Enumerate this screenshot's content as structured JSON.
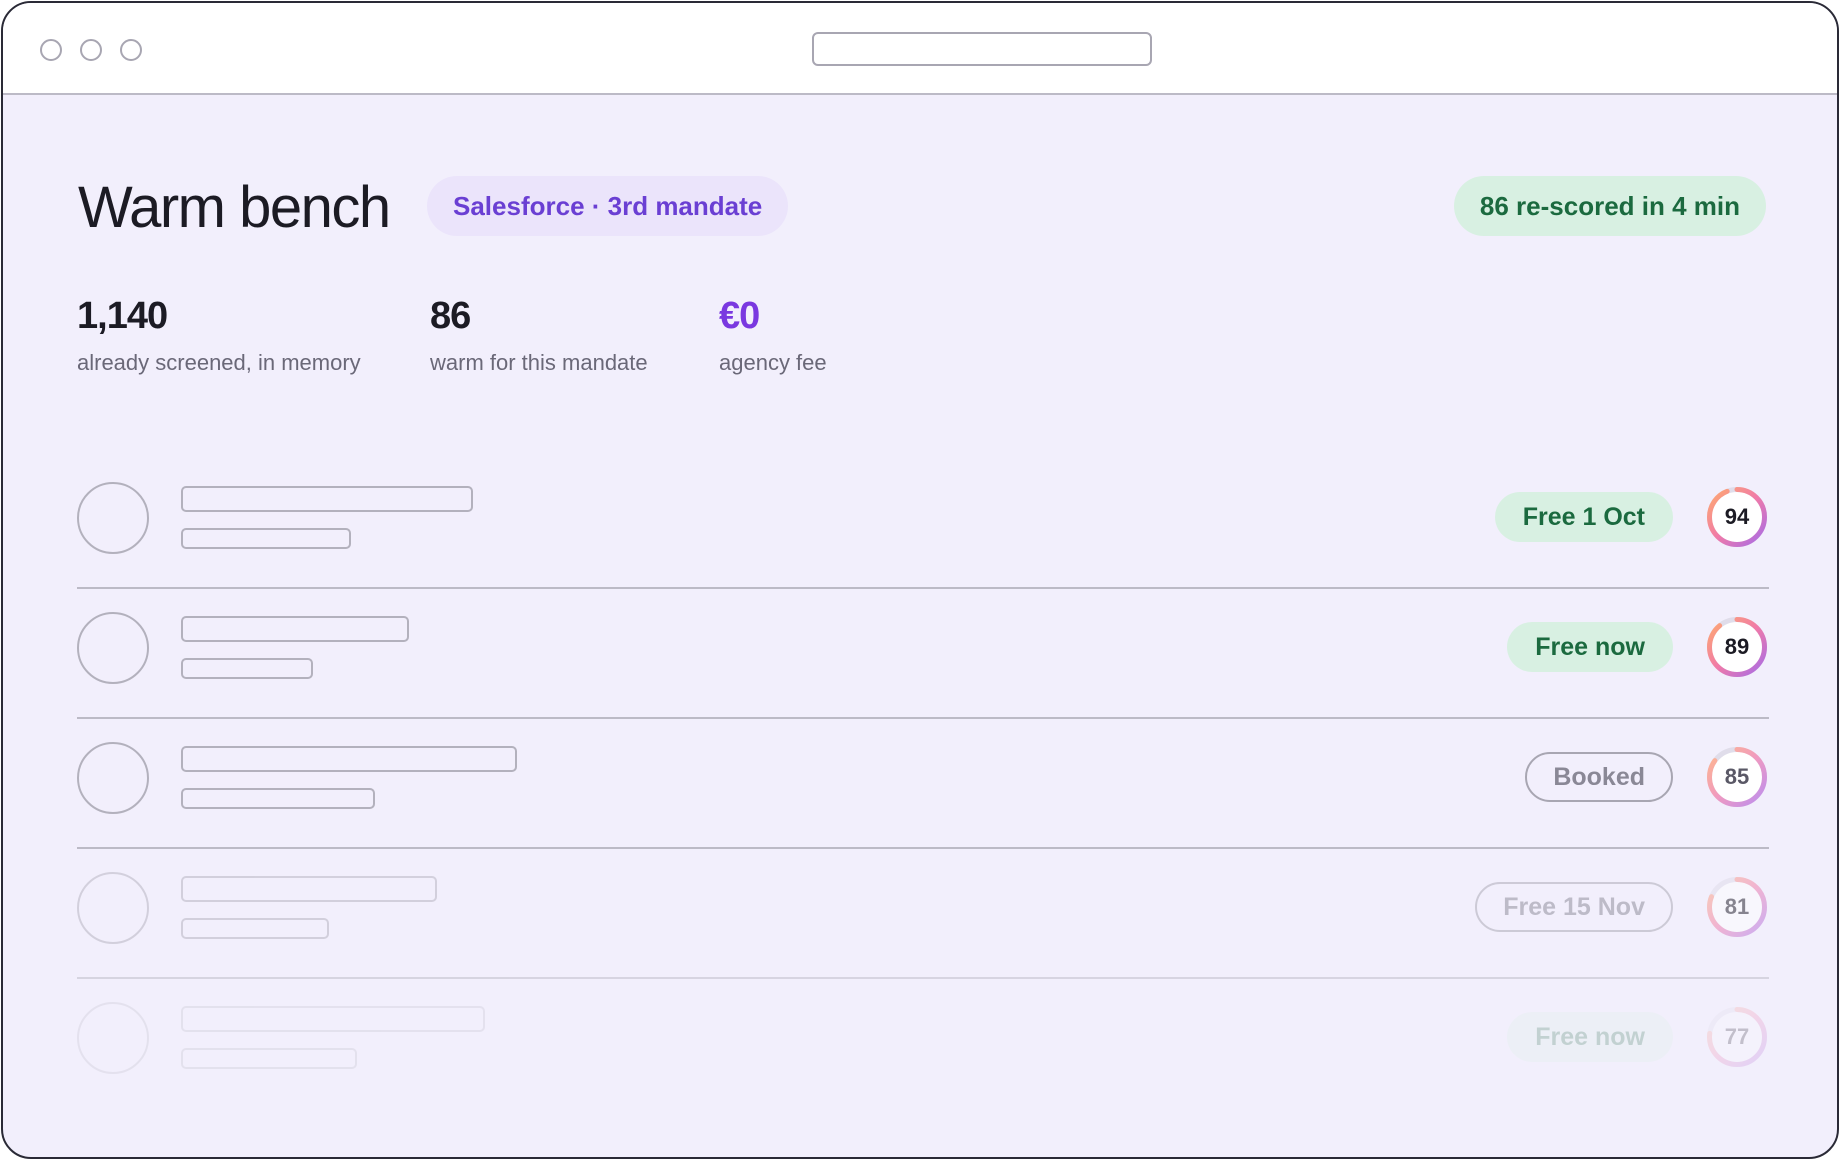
{
  "header": {
    "title": "Warm bench",
    "mandate_badge": "Salesforce · 3rd mandate",
    "status_badge": "86 re-scored in 4 min",
    "colors": {
      "accent": "#7a38e0",
      "mandate_badge_text": "#6a3fd3",
      "free_green": "#1b6a3f",
      "free_green_bg": "#d8f0e2",
      "background": "#f2effc"
    }
  },
  "stats": [
    {
      "value": "1,140",
      "label": "already screened, in memory"
    },
    {
      "value": "86",
      "label": "warm for this mandate"
    },
    {
      "value": "€0",
      "label": "agency fee"
    }
  ],
  "candidates": [
    {
      "availability": "Free 1 Oct",
      "availability_status": "free",
      "score": 94,
      "score_label": "94"
    },
    {
      "availability": "Free now",
      "availability_status": "free",
      "score": 89,
      "score_label": "89"
    },
    {
      "availability": "Booked",
      "availability_status": "booked",
      "score": 85,
      "score_label": "85"
    },
    {
      "availability": "Free 15 Nov",
      "availability_status": "booked",
      "score": 81,
      "score_label": "81"
    },
    {
      "availability": "Free now",
      "availability_status": "free",
      "score": 77,
      "score_label": "77"
    }
  ]
}
